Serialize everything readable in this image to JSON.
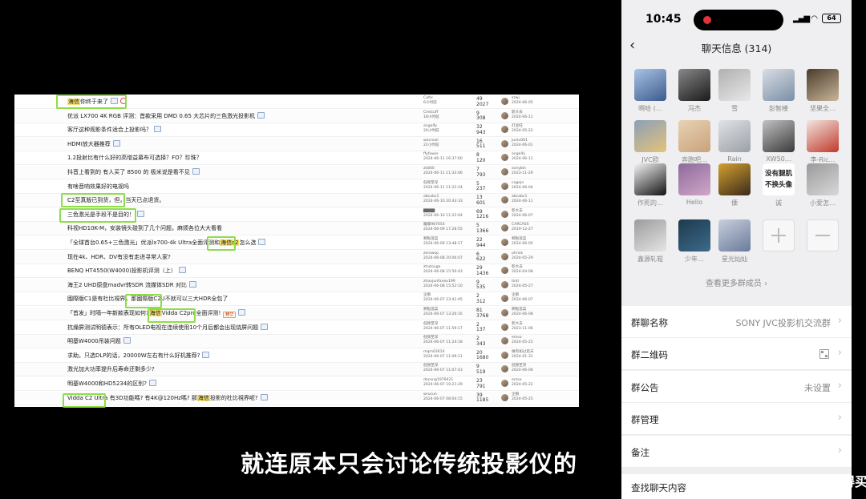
{
  "forum": {
    "rows": [
      {
        "title_pre": "",
        "hl": "海信",
        "title_post": "你终于来了",
        "icons": [
          "img",
          "hot"
        ],
        "author": "Coltx",
        "date": "6小时前",
        "replies": "49",
        "views": "2027",
        "last_user": "szwj",
        "last_date": "2024-06-05"
      },
      {
        "title_pre": "优派 LX700 4K RGB 评测：首款采用 DMD 0.65 大芯片的三色激光投影机",
        "hl": "",
        "title_post": "",
        "icons": [
          "img"
        ],
        "author": "Cretcuff",
        "date": "18小时前",
        "replies": "9",
        "views": "308",
        "last_user": "影大去",
        "last_date": "2024-06-11"
      },
      {
        "title_pre": "客厅这种观影条件适合上投影吗？",
        "hl": "",
        "title_post": "",
        "icons": [
          "img"
        ],
        "author": "angelfy",
        "date": "20小时前",
        "replies": "32",
        "views": "943",
        "last_user": "打豆旺",
        "last_date": "2024-05-22"
      },
      {
        "title_pre": "HDMI放大器推荐",
        "hl": "",
        "title_post": "",
        "icons": [
          "img"
        ],
        "author": "wocnoxl",
        "date": "22小时前",
        "replies": "16",
        "views": "511",
        "last_user": "junlu001",
        "last_date": "2024-06-01"
      },
      {
        "title_pre": "1.2投射比有什么好的高增益幕布可选择？FO？珍珠？",
        "hl": "",
        "title_post": "",
        "icons": [],
        "author": "ffyfower",
        "date": "2024-06-11 16:37:00",
        "replies": "8",
        "views": "120",
        "last_user": "angelhj",
        "last_date": "2024-06-11"
      },
      {
        "title_pre": "抖音上看到的 有人买了 8500 的 极米说是看不见",
        "hl": "",
        "title_post": "",
        "icons": [
          "img"
        ],
        "author": "zk840",
        "date": "2024-06-11 11:33:06",
        "replies": "7",
        "views": "793",
        "last_user": "sonybin",
        "last_date": "2023-11-29"
      },
      {
        "title_pre": "有啥音响效果好的电视吗",
        "hl": "",
        "title_post": "",
        "icons": [],
        "author": "低频至深",
        "date": "2024-06-11 11:22:24",
        "replies": "5",
        "views": "237",
        "last_user": "cagejn",
        "last_date": "2024-06-04"
      },
      {
        "title_pre": "C2至真版已到货，但，当天已点退货。",
        "hl": "",
        "title_post": "",
        "icons": [],
        "author": "abcabc1",
        "date": "2024-06-10 20:43:33",
        "replies": "13",
        "views": "601",
        "last_user": "abcabc1",
        "last_date": "2024-06-11"
      },
      {
        "title_pre": "三色激光是手段不是目的！",
        "hl": "",
        "title_post": "",
        "icons": [
          "img"
        ],
        "author": "▇▇▇▇",
        "date": "2024-06-10 11:22:04",
        "replies": "69",
        "views": "1216",
        "last_user": "影大去",
        "last_date": "2024-06-07"
      },
      {
        "title_pre": "科视HD10K-M，安装镜头碰到了几个问题，麻烦各位大大看看",
        "hl": "",
        "title_post": "",
        "icons": [],
        "author": "瞳摩987654",
        "date": "2024-06-09 17:28:55",
        "replies": "5",
        "views": "1366",
        "last_user": "CARCASS",
        "last_date": "2019-12-27"
      },
      {
        "title_pre": "「全球首台0.65+三色激光」优派lx700-4k Ultra全面评测和",
        "hl": "海信c2",
        "title_post": "怎么选",
        "icons": [
          "img"
        ],
        "author": "啊啦莲菜",
        "date": "2024-06-09 13:48:17",
        "replies": "22",
        "views": "944",
        "last_user": "啊啦莲菜",
        "last_date": "2024-06-05"
      },
      {
        "title_pre": "现在4k、HDR、DV有没有走进寻常人家?",
        "hl": "",
        "title_post": "",
        "icons": [],
        "author": "zerowsp",
        "date": "2024-06-08 20:06:07",
        "replies": "6",
        "views": "622",
        "last_user": "ohrick",
        "last_date": "2024-05-29"
      },
      {
        "title_pre": "BENQ HT4550(W4000)投影机评测（上）",
        "hl": "",
        "title_post": "",
        "icons": [
          "img"
        ],
        "author": "zhutouge",
        "date": "2024-06-08 15:56:43",
        "replies": "29",
        "views": "1436",
        "last_user": "影大去",
        "last_date": "2024-04-08"
      },
      {
        "title_pre": "海王2 UHD原盘madvr转SDR 流媒体SDR 对比",
        "hl": "",
        "title_post": "",
        "icons": [
          "img"
        ],
        "author": "zhoujunfanex199",
        "date": "2024-06-08 15:52:10",
        "replies": "9",
        "views": "535",
        "last_user": "tinti",
        "last_date": "2024-05-27"
      },
      {
        "title_pre": "國際版C1是有杜比視界，那國際版C2U不就可以三大HDR全包了",
        "hl": "",
        "title_post": "",
        "icons": [],
        "author": "企鹅",
        "date": "2024-06-07 23:41:45",
        "replies": "2",
        "views": "312",
        "last_user": "企鹅",
        "last_date": "2024-06-07"
      },
      {
        "title_pre": "「首发」时隔一年新款表现如何?",
        "hl": "海信",
        "title_post": "Vidda C2pro全面评测!",
        "icons": [
          "tag",
          "img"
        ],
        "author": "啊啦莲菜",
        "date": "2024-06-07 13:26:35",
        "replies": "81",
        "views": "3768",
        "last_user": "啊啦莲菜",
        "last_date": "2024-06-08"
      },
      {
        "title_pre": "抗燥屏测试明德表示：所有OLED电视在连续使用10个月后都会出现烧屏问题",
        "hl": "",
        "title_post": "",
        "icons": [
          "img"
        ],
        "author": "低频至深",
        "date": "2024-06-07 11:59:17",
        "replies": "2",
        "views": "137",
        "last_user": "影大去",
        "last_date": "2023-11-06"
      },
      {
        "title_pre": "明基W4000吊装问题",
        "hl": "",
        "title_post": "",
        "icons": [
          "img"
        ],
        "author": "低频至深",
        "date": "2024-06-07 11:24:18",
        "replies": "2",
        "views": "343",
        "last_user": "emso",
        "last_date": "2024-05-25"
      },
      {
        "title_pre": "求助。只选DLP的话，20000W左右有什么好机推荐?",
        "hl": "",
        "title_post": "",
        "icons": [
          "img"
        ],
        "author": "mqm03610",
        "date": "2024-06-07 11:09:11",
        "replies": "20",
        "views": "1680",
        "last_user": "做有如过后天",
        "last_date": "2024-01-31"
      },
      {
        "title_pre": "激光加大功率提升后寿命还剩多少?",
        "hl": "",
        "title_post": "",
        "icons": [],
        "author": "低频至深",
        "date": "2024-06-07 11:07:43",
        "replies": "9",
        "views": "519",
        "last_user": "低频至深",
        "last_date": "2024-06-06"
      },
      {
        "title_pre": "明基W4000和HD5234的区别?",
        "hl": "",
        "title_post": "",
        "icons": [
          "img"
        ],
        "author": "dacong1979421",
        "date": "2024-06-07 10:21:29",
        "replies": "23",
        "views": "791",
        "last_user": "emso",
        "last_date": "2024-05-22"
      },
      {
        "title_pre": "Vidda C2 Ultra 有3D功能嗎? 有4K@120Hz嗎? 那",
        "hl": "海信",
        "title_post": "投影的杜比視界呢?",
        "icons": [
          "img"
        ],
        "author": "wrucun",
        "date": "2024-06-07 08:04:15",
        "replies": "39",
        "views": "1185",
        "last_user": "企鹅",
        "last_date": "2024-05-25"
      }
    ],
    "hot_tag": "精华"
  },
  "subtitle": "就连原本只会讨论传统投影仪的",
  "phone": {
    "time": "10:45",
    "battery": "64",
    "nav_title": "聊天信息 (314)",
    "members": [
      {
        "name": "啊哈 (…",
        "c1": "#3b5a8c",
        "c2": "#a9c4e6"
      },
      {
        "name": "冯杰",
        "c1": "#1a1a1a",
        "c2": "#888888"
      },
      {
        "name": "雪",
        "c1": "#e8e8e8",
        "c2": "#b0b0b0"
      },
      {
        "name": "彭智楼",
        "c1": "#7a8fa6",
        "c2": "#d9dde3"
      },
      {
        "name": "坚果全…",
        "c1": "#c9b79a",
        "c2": "#4a3a2a"
      },
      {
        "name": "JVC欧",
        "c1": "#e6c27a",
        "c2": "#8aa0b8"
      },
      {
        "name": "奔跑吧…",
        "c1": "#c9a27a",
        "c2": "#e8d2b5"
      },
      {
        "name": "Rain",
        "c1": "#9aa0a8",
        "c2": "#e0e2e5"
      },
      {
        "name": "XW50…",
        "c1": "#3a3a3a",
        "c2": "#c2c2c2"
      },
      {
        "name": "李-Ric…",
        "c1": "#c0392b",
        "c2": "#f2e6e0"
      },
      {
        "name": "作死的…",
        "c1": "#111111",
        "c2": "#f5f5f5"
      },
      {
        "name": "Hello",
        "c1": "#d1a7c9",
        "c2": "#8c6a9a"
      },
      {
        "name": "傈",
        "c1": "#3a2a1a",
        "c2": "#d4a030"
      },
      {
        "name": "诚",
        "c1": "#ffffff",
        "c2": "#ffffff"
      },
      {
        "name": "小爱怎…",
        "c1": "#d8d8d8",
        "c2": "#9a9a9a"
      },
      {
        "name": "鑫源轧辊",
        "c1": "#e5e5e5",
        "c2": "#9b9b9b"
      },
      {
        "name": "少年…",
        "c1": "#3c6a8c",
        "c2": "#1e3a4c"
      },
      {
        "name": "星光灿灿",
        "c1": "#6a7a9a",
        "c2": "#c9d0de"
      }
    ],
    "text_avatar_line1": "没有腿肌",
    "text_avatar_line2": "不换头像",
    "see_more": "查看更多群成员 ›",
    "group_name_label": "群聊名称",
    "group_name_value": "SONY JVC投影机交流群",
    "qr_label": "群二维码",
    "notice_label": "群公告",
    "notice_value": "未设置",
    "manage_label": "群管理",
    "remark_label": "备注",
    "search_label": "查找聊天内容"
  },
  "watermark": "什么值得买",
  "watermark_logo": "值"
}
